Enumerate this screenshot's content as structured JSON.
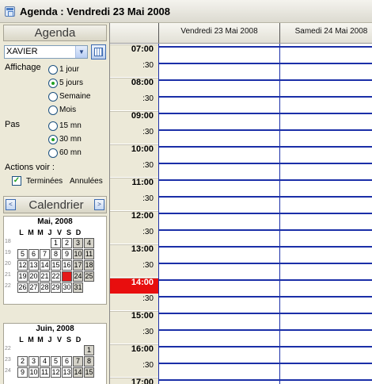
{
  "window": {
    "title": "Agenda : Vendredi 23 Mai 2008"
  },
  "sidebar": {
    "agenda_header": "Agenda",
    "user_select": {
      "value": "XAVIER"
    },
    "affichage": {
      "label": "Affichage",
      "options": [
        "1 jour",
        "5 jours",
        "Semaine",
        "Mois"
      ],
      "selected": "5 jours"
    },
    "pas": {
      "label": "Pas",
      "options": [
        "15 mn",
        "30 mn",
        "60 mn"
      ],
      "selected": "30 mn"
    },
    "actions": {
      "label": "Actions voir :",
      "terminees_label": "Terminées",
      "terminees_checked": true,
      "annulees_label": "Annulées"
    },
    "calendar": {
      "header": "Calendrier",
      "prev_icon": "<",
      "next_icon": ">",
      "day_headers": [
        "L",
        "M",
        "M",
        "J",
        "V",
        "S",
        "D"
      ],
      "months": [
        {
          "title": "Mai, 2008",
          "weeks": [
            {
              "num": "18",
              "days": [
                "",
                "",
                "",
                "1",
                "2",
                "3",
                "4"
              ]
            },
            {
              "num": "19",
              "days": [
                "5",
                "6",
                "7",
                "8",
                "9",
                "10",
                "11"
              ]
            },
            {
              "num": "20",
              "days": [
                "12",
                "13",
                "14",
                "15",
                "16",
                "17",
                "18"
              ]
            },
            {
              "num": "21",
              "days": [
                "19",
                "20",
                "21",
                "22",
                "23",
                "24",
                "25"
              ]
            },
            {
              "num": "22",
              "days": [
                "26",
                "27",
                "28",
                "29",
                "30",
                "31",
                ""
              ]
            }
          ],
          "today": "23"
        },
        {
          "title": "Juin, 2008",
          "weeks": [
            {
              "num": "22",
              "days": [
                "",
                "",
                "",
                "",
                "",
                "",
                "1"
              ]
            },
            {
              "num": "23",
              "days": [
                "2",
                "3",
                "4",
                "5",
                "6",
                "7",
                "8"
              ]
            },
            {
              "num": "24",
              "days": [
                "9",
                "10",
                "11",
                "12",
                "13",
                "14",
                "15"
              ]
            }
          ]
        }
      ]
    }
  },
  "agenda": {
    "day_columns": [
      "Vendredi 23 Mai 2008",
      "Samedi 24 Mai 2008"
    ],
    "time_labels": [
      "07:00",
      ":30",
      "08:00",
      ":30",
      "09:00",
      ":30",
      "10:00",
      ":30",
      "11:00",
      ":30",
      "12:00",
      ":30",
      "13:00",
      ":30",
      "14:00",
      ":30",
      "15:00",
      ":30",
      "16:00",
      ":30",
      "17:00"
    ],
    "current_time_label": "14:00",
    "current_time_color": "#e80e0e",
    "grid_line_color": "#1b2fa8"
  }
}
